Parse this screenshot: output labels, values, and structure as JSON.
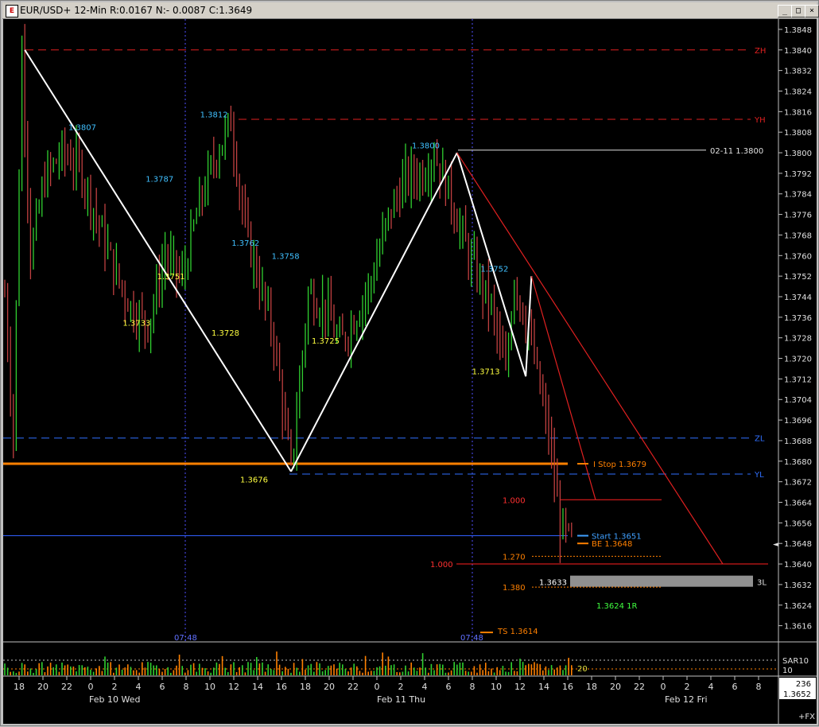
{
  "window": {
    "title": "EUR/USD+ 12-Min R:0.0167 N:- 0.0087 C:1.3649",
    "icon": "chart-app-icon",
    "buttons": {
      "minimize": "_",
      "maximize": "□",
      "close": "×"
    }
  },
  "chart_data": {
    "type": "candlestick",
    "symbol": "EUR/USD+",
    "interval": "12-Min",
    "last_close": "1.3649",
    "ylim": [
      1.361,
      1.3852
    ],
    "y_ticks": [
      "1.3848",
      "1.3840",
      "1.3832",
      "1.3824",
      "1.3816",
      "1.3808",
      "1.3800",
      "1.3792",
      "1.3784",
      "1.3776",
      "1.3768",
      "1.3760",
      "1.3752",
      "1.3744",
      "1.3736",
      "1.3728",
      "1.3720",
      "1.3712",
      "1.3704",
      "1.3696",
      "1.3688",
      "1.3680",
      "1.3672",
      "1.3664",
      "1.3656",
      "1.3648",
      "1.3640",
      "1.3632",
      "1.3624",
      "1.3616"
    ],
    "x_ticks": [
      "18",
      "20",
      "22",
      "0",
      "2",
      "4",
      "6",
      "8",
      "10",
      "12",
      "14",
      "16",
      "18",
      "20",
      "22",
      "0",
      "2",
      "4",
      "6",
      "8",
      "10",
      "12",
      "14",
      "16",
      "18",
      "20",
      "22",
      "0",
      "2",
      "4",
      "6",
      "8"
    ],
    "x_day_labels": [
      "Feb 10 Wed",
      "Feb 11 Thu",
      "Feb 12 Fri"
    ],
    "x_marker_time_labels": [
      "07:48",
      "07:48"
    ],
    "grid": true,
    "price_path": [
      {
        "t": 0,
        "p": 1.3745
      },
      {
        "t": 3,
        "p": 1.369
      },
      {
        "t": 6,
        "p": 1.384
      },
      {
        "t": 9,
        "p": 1.376
      },
      {
        "t": 14,
        "p": 1.379
      },
      {
        "t": 20,
        "p": 1.38
      },
      {
        "t": 26,
        "p": 1.3795
      },
      {
        "t": 32,
        "p": 1.3775
      },
      {
        "t": 38,
        "p": 1.3755
      },
      {
        "t": 44,
        "p": 1.374
      },
      {
        "t": 50,
        "p": 1.3733
      },
      {
        "t": 56,
        "p": 1.376
      },
      {
        "t": 62,
        "p": 1.3751
      },
      {
        "t": 68,
        "p": 1.378
      },
      {
        "t": 74,
        "p": 1.38
      },
      {
        "t": 79,
        "p": 1.3812
      },
      {
        "t": 84,
        "p": 1.377
      },
      {
        "t": 90,
        "p": 1.3745
      },
      {
        "t": 94,
        "p": 1.3728
      },
      {
        "t": 100,
        "p": 1.3676
      },
      {
        "t": 106,
        "p": 1.3745
      },
      {
        "t": 112,
        "p": 1.374
      },
      {
        "t": 117,
        "p": 1.3725
      },
      {
        "t": 122,
        "p": 1.3735
      },
      {
        "t": 128,
        "p": 1.375
      },
      {
        "t": 134,
        "p": 1.3775
      },
      {
        "t": 140,
        "p": 1.379
      },
      {
        "t": 146,
        "p": 1.3792
      },
      {
        "t": 150,
        "p": 1.38
      },
      {
        "t": 155,
        "p": 1.3785
      },
      {
        "t": 162,
        "p": 1.376
      },
      {
        "t": 170,
        "p": 1.374
      },
      {
        "t": 175,
        "p": 1.3713
      },
      {
        "t": 178,
        "p": 1.3752
      },
      {
        "t": 184,
        "p": 1.3725
      },
      {
        "t": 190,
        "p": 1.369
      },
      {
        "t": 194,
        "p": 1.3655
      },
      {
        "t": 198,
        "p": 1.3648
      }
    ],
    "total_bars": 316,
    "volume_series_label": "SAR10",
    "volume_level_labels": [
      "20",
      "10"
    ],
    "right_panel_values": [
      "236",
      "1.3652"
    ],
    "fx_label": "+FX",
    "pivots": [
      {
        "bar": 7,
        "price": 1.384
      },
      {
        "bar": 100,
        "price": 1.3676
      },
      {
        "bar": 158,
        "price": 1.38
      },
      {
        "bar": 182,
        "price": 1.3713
      },
      {
        "bar": 184,
        "price": 1.3752
      },
      {
        "bar": 198,
        "price": 1.3633
      }
    ],
    "swing_labels": [
      {
        "text": "1.3807",
        "bar": 30,
        "price": 1.381,
        "color": "#40c0ff"
      },
      {
        "text": "1.3787",
        "bar": 57,
        "price": 1.379,
        "color": "#40c0ff"
      },
      {
        "text": "1.3812",
        "bar": 76,
        "price": 1.3815,
        "color": "#40c0ff"
      },
      {
        "text": "1.3762",
        "bar": 87,
        "price": 1.3765,
        "color": "#40c0ff"
      },
      {
        "text": "1.3758",
        "bar": 101,
        "price": 1.376,
        "color": "#40c0ff"
      },
      {
        "text": "1.3800",
        "bar": 150,
        "price": 1.3803,
        "color": "#40c0ff"
      },
      {
        "text": "1.3752",
        "bar": 174,
        "price": 1.3755,
        "color": "#40c0ff"
      },
      {
        "text": "1.3751",
        "bar": 61,
        "price": 1.3752,
        "color": "#ffff40"
      },
      {
        "text": "1.3733",
        "bar": 49,
        "price": 1.3734,
        "color": "#ffff40"
      },
      {
        "text": "1.3728",
        "bar": 80,
        "price": 1.373,
        "color": "#ffff40"
      },
      {
        "text": "1.3725",
        "bar": 115,
        "price": 1.3727,
        "color": "#ffff40"
      },
      {
        "text": "1.3713",
        "bar": 171,
        "price": 1.3715,
        "color": "#ffff40"
      },
      {
        "text": "1.3676",
        "bar": 90,
        "price": 1.3673,
        "color": "#ffff40"
      }
    ],
    "levels": [
      {
        "label": "ZH",
        "price": 1.384,
        "color": "#e02020",
        "style": "dash"
      },
      {
        "label": "YH",
        "price": 1.3813,
        "color": "#e02020",
        "style": "dash"
      },
      {
        "label": "02-11 1.3800",
        "price": 1.3801,
        "color": "#e0e0e0",
        "style": "solid"
      },
      {
        "label": "ZL",
        "price": 1.3689,
        "color": "#3070ff",
        "style": "dash"
      },
      {
        "label": "YL",
        "price": 1.3675,
        "color": "#3070ff",
        "style": "dash"
      },
      {
        "label": "3L",
        "price": 1.3633,
        "color": "#ffffff",
        "style": "solid"
      }
    ],
    "trade_labels": [
      {
        "text": "I Stop 1.3679",
        "price": 1.3679,
        "color": "#ff8000"
      },
      {
        "text": "Start 1.3651",
        "price": 1.3651,
        "color": "#40a0ff"
      },
      {
        "text": "BE 1.3648",
        "price": 1.3648,
        "color": "#ff8000"
      },
      {
        "text": "1.3624 1R",
        "price": 1.3624,
        "color": "#40ff40"
      },
      {
        "text": "TS 1.3614",
        "price": 1.3614,
        "color": "#ff8000"
      },
      {
        "text": "1.000",
        "price": 1.3665,
        "color": "#ff3030"
      },
      {
        "text": "1.000",
        "price": 1.364,
        "color": "#ff3030"
      },
      {
        "text": "1.270",
        "price": 1.3643,
        "color": "#ff8000"
      },
      {
        "text": "1.380",
        "price": 1.3631,
        "color": "#ff8000"
      },
      {
        "text": "1.3633",
        "price": 1.3633,
        "color": "#ffffff"
      }
    ]
  }
}
